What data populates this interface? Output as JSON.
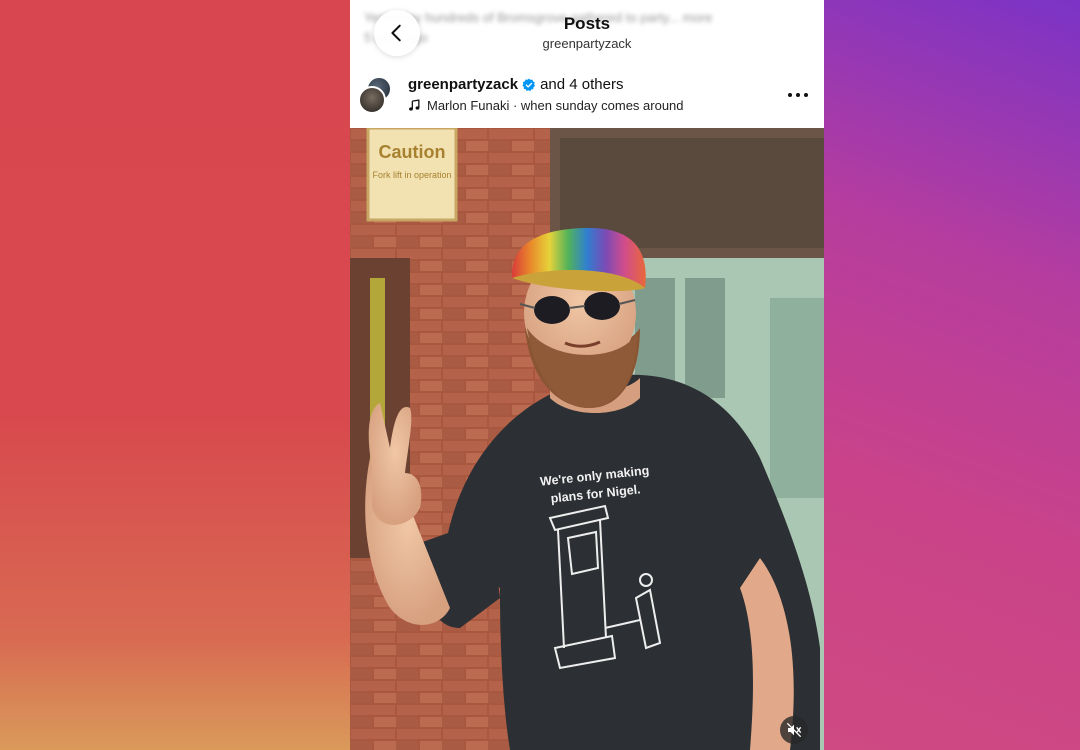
{
  "header": {
    "title": "Posts",
    "subtitle": "greenpartyzack",
    "blurred_caption": "Yesterday hundreds of Bromsgrove gathered to party... more",
    "blurred_time": "5 days ago"
  },
  "post": {
    "username": "greenpartyzack",
    "collaborators": "and 4 others",
    "audio": "Marlon Funaki · when sunday comes around",
    "verified": true
  },
  "photo": {
    "sign_text": "Caution",
    "sign_subtext": "Fork lift in operation",
    "shirt_line1": "We're only making",
    "shirt_line2": "plans for Nigel."
  },
  "icons": {
    "back": "chevron-left-icon",
    "verified": "verified-badge-icon",
    "music": "music-note-icon",
    "more": "more-horizontal-icon",
    "mute": "speaker-muted-icon"
  },
  "colors": {
    "verified_blue": "#0095f6",
    "bg_left": "#d8474f",
    "bg_right": "#7b33c6"
  }
}
